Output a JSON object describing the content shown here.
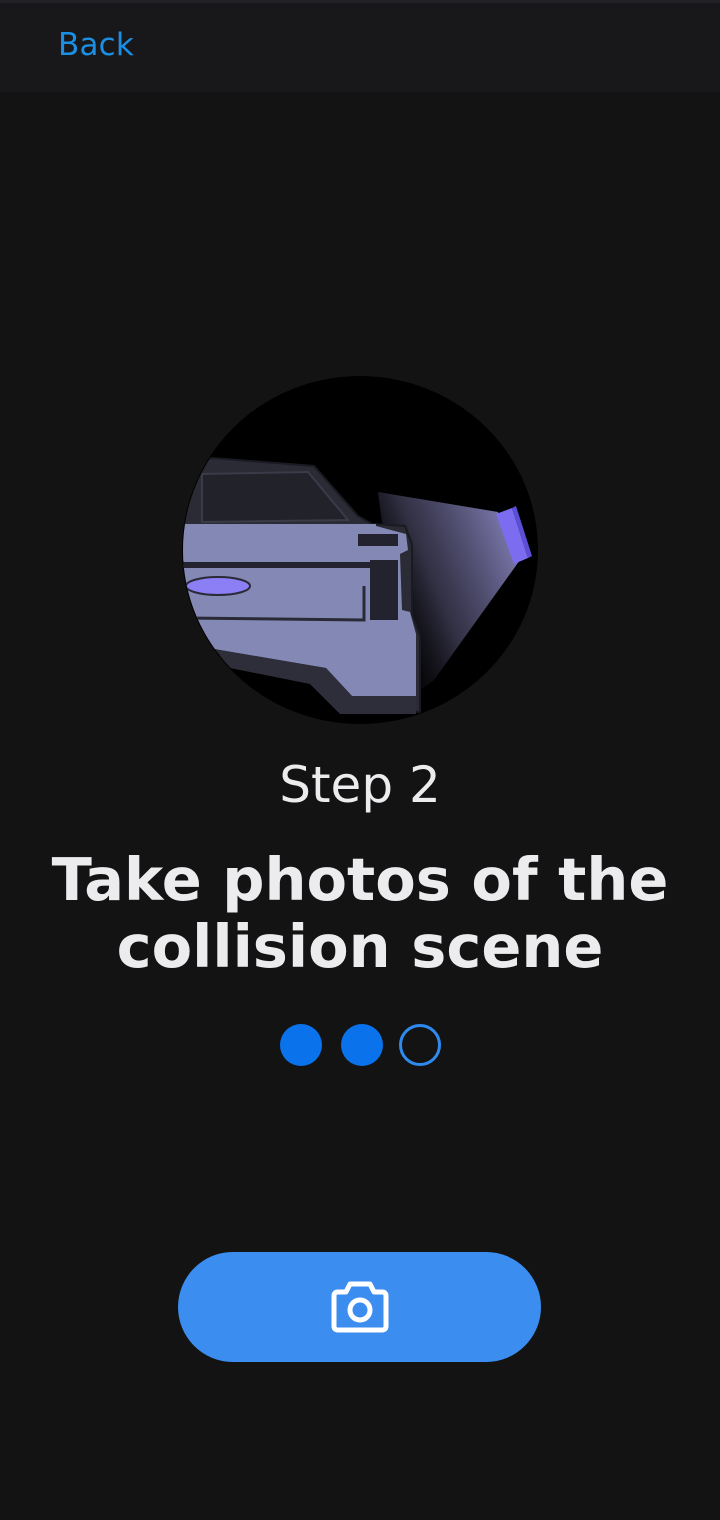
{
  "nav": {
    "back_label": "Back"
  },
  "onboarding": {
    "step_label": "Step 2",
    "title": "Take photos of the collision scene",
    "progress": {
      "total_steps": 3,
      "completed_steps": 2
    }
  },
  "actions": {
    "primary_icon": "camera-icon"
  },
  "colors": {
    "background": "#131314",
    "nav_background": "#18181b",
    "accent_link": "#1a8fe3",
    "dot_active": "#0a73ec",
    "button": "#3b8def",
    "text": "#ececee",
    "illustration_car": "#8488b5",
    "illustration_light": "#7b6cf0"
  }
}
